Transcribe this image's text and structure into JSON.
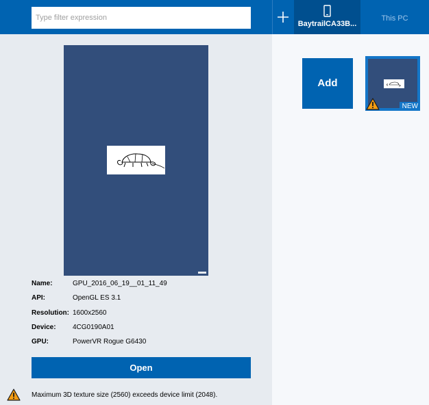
{
  "search": {
    "placeholder": "Type filter expression"
  },
  "toolbar": {
    "add_icon": "plus-icon"
  },
  "tabs": [
    {
      "label": "BaytrailCA33B...",
      "icon": "phone-icon",
      "selected": true
    },
    {
      "label": "This PC",
      "selected": false
    }
  ],
  "capture": {
    "fields": [
      {
        "key": "Name:",
        "value": "GPU_2016_06_19__01_11_49"
      },
      {
        "key": "API:",
        "value": "OpenGL ES 3.1"
      },
      {
        "key": "Resolution:",
        "value": "1600x2560"
      },
      {
        "key": "Device:",
        "value": "4CG0190A01"
      },
      {
        "key": "GPU:",
        "value": "PowerVR Rogue G6430"
      }
    ],
    "open_label": "Open",
    "warning": "Maximum 3D texture size (2560) exceeds device limit (2048).",
    "warning_icon": "warning-icon"
  },
  "gallery": {
    "add_label": "Add",
    "items": [
      {
        "badge": "NEW",
        "warning": true
      }
    ]
  },
  "colors": {
    "accent": "#0063b1",
    "selected_tab": "#004f8f",
    "preview_bg": "#324e7b",
    "warning": "#f39c12"
  }
}
